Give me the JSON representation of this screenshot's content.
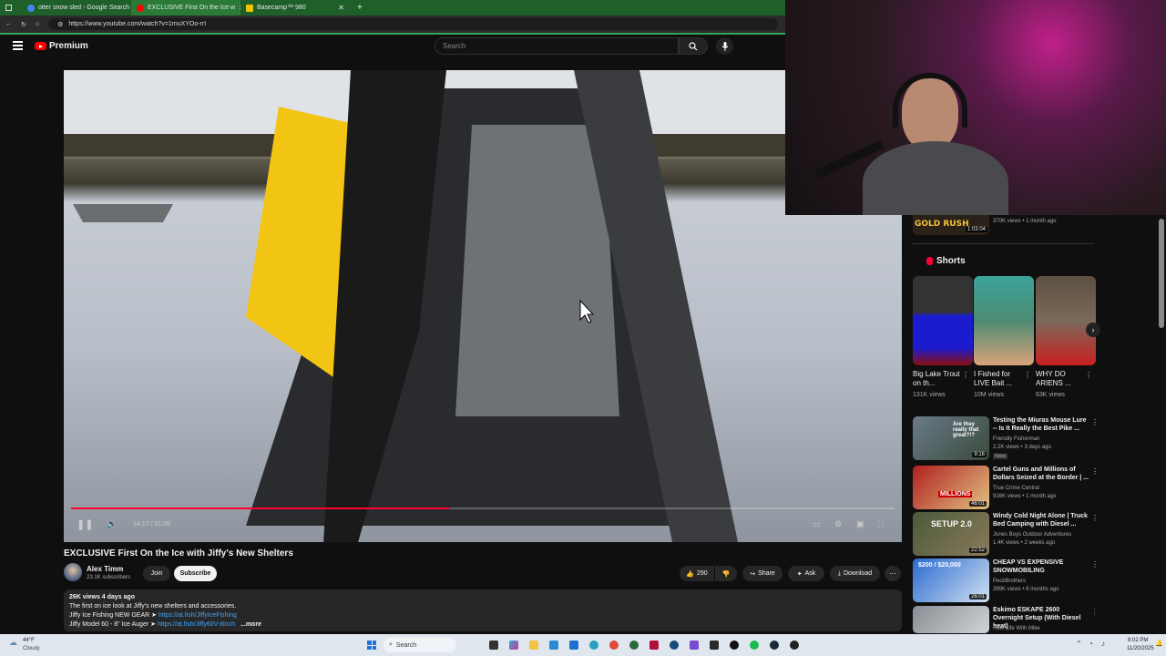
{
  "browser": {
    "tabs": [
      {
        "label": "otter snow sled - Google Search",
        "color": "#4285f4"
      },
      {
        "label": "EXCLUSIVE First On the Ice w",
        "color": "#ff0000"
      },
      {
        "label": "Basecamp™ 980",
        "color": "#f2c300"
      }
    ],
    "url": "https://www.youtube.com/watch?v=1muXYOo-rrI"
  },
  "youtube": {
    "brand": "Premium",
    "search_placeholder": "Search"
  },
  "video": {
    "time": "14:17 / 31:05",
    "progress": 0.46,
    "title": "EXCLUSIVE First On the Ice with Jiffy's New Shelters",
    "channel": "Alex Timm",
    "subscribers": "23.1K subscribers",
    "join_label": "Join",
    "subscribe_label": "Subscribe",
    "likes": "290",
    "share_label": "Share",
    "ask_label": "Ask",
    "download_label": "Download",
    "meta": "26K views  4 days ago",
    "desc_line1": "The first on ice look at Jiffy's new shelters and accessories.",
    "desc_line2_prefix": "Jiffy Ice Fishing NEW GEAR ➤ ",
    "desc_line2_link": "https://at.fish/JiffyIceFishing",
    "desc_line3_prefix": "Jiffy Model 60 - 8\" Ice Auger ➤ ",
    "desc_line3_link": "https://at.fish/Jiffy60V-8inch",
    "more_label": "...more"
  },
  "sidebar": {
    "top_item": {
      "thumb_text": "GOLD RUSH",
      "duration": "1:03:04",
      "meta": "370K views • 1 month ago"
    },
    "shorts_title": "Shorts",
    "shorts": [
      {
        "title": "Big Lake Trout on th...",
        "views": "131K views"
      },
      {
        "title": "I Fished for LIVE Bait ...",
        "views": "10M views"
      },
      {
        "title": "WHY DO ARIENS ...",
        "views": "63K views"
      }
    ],
    "recommended": [
      {
        "title": "Testing the Miuras Mouse Lure -- Is It Really the Best Pike ...",
        "channel": "Friendly Fisherman",
        "meta": "2.2K views • 3 days ago",
        "badge": "New",
        "duration": "9:16",
        "thumb_text": "Are they really that great?!?"
      },
      {
        "title": "Cartel Guns and Millions of Dollars Seized at the Border | ...",
        "channel": "True Crime Central",
        "meta": "916K views • 1 month ago",
        "badge": "",
        "duration": "46:01",
        "thumb_text": "MILLIONS"
      },
      {
        "title": "Windy Cold Night Alone | Truck Bed Camping with Diesel ...",
        "channel": "Jones Boys Outdoor Adventures",
        "meta": "1.4K views • 2 weeks ago",
        "badge": "",
        "duration": "22:52",
        "thumb_text": "SETUP 2.0"
      },
      {
        "title": "CHEAP VS EXPENSIVE SNOWMOBILING",
        "channel": "PeckBrothers",
        "meta": "399K views • 8 months ago",
        "badge": "",
        "duration": "26:01",
        "thumb_text": "$200 / $20,000"
      },
      {
        "title": "Eskimo ESKAPE 2600 Overnight Setup (With Diesel heat)",
        "channel": "Reel Life With Mike",
        "meta": "",
        "badge": "",
        "duration": "",
        "thumb_text": ""
      }
    ]
  },
  "taskbar": {
    "weather_temp": "44°F",
    "weather_desc": "Cloudy",
    "search_label": "Search",
    "time": "8:02 PM",
    "date": "11/20/2025"
  },
  "colors": {
    "accent": "#ff0000",
    "bg": "#0f0f0f",
    "tabbar": "#1f5f2a"
  }
}
